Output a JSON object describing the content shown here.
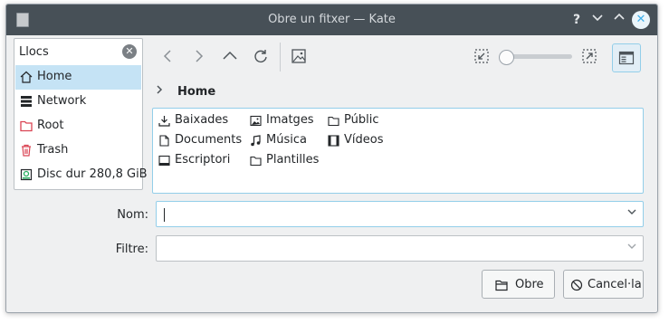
{
  "window": {
    "title": "Obre un fitxer — Kate"
  },
  "titlebar": {
    "help": "?",
    "close": "✕"
  },
  "places": {
    "header": "Llocs",
    "items": [
      {
        "label": "Home",
        "icon": "home-icon",
        "selected": true
      },
      {
        "label": "Network",
        "icon": "network-icon"
      },
      {
        "label": "Root",
        "icon": "folder-red-icon",
        "color": "#da4453"
      },
      {
        "label": "Trash",
        "icon": "trash-icon",
        "color": "#da4453"
      },
      {
        "label": "Disc dur 280,8 GiB",
        "icon": "drive-icon",
        "color": "#27ae60"
      }
    ]
  },
  "toolbar": {
    "back": "back-icon",
    "forward": "forward-icon",
    "up": "up-icon",
    "reload": "reload-icon",
    "preview": "image-preview-icon",
    "zoom_out": "zoom-out-icon",
    "zoom_in": "zoom-in-icon",
    "zoom_level": 0,
    "panel": "show-panel-icon"
  },
  "breadcrumb": {
    "path": "Home"
  },
  "files": [
    {
      "label": "Baixades",
      "icon": "download-folder-icon"
    },
    {
      "label": "Documents",
      "icon": "document-folder-icon"
    },
    {
      "label": "Escriptori",
      "icon": "desktop-folder-icon"
    },
    {
      "label": "Imatges",
      "icon": "pictures-folder-icon"
    },
    {
      "label": "Música",
      "icon": "music-folder-icon"
    },
    {
      "label": "Plantilles",
      "icon": "folder-icon"
    },
    {
      "label": "Públic",
      "icon": "folder-icon"
    },
    {
      "label": "Vídeos",
      "icon": "video-folder-icon"
    }
  ],
  "form": {
    "name_label": "Nom:",
    "name_value": "",
    "filter_label": "Filtre:",
    "filter_value": ""
  },
  "buttons": {
    "open": "Obre",
    "cancel": "Cancel·la"
  },
  "colors": {
    "titlebar": "#475057",
    "accent": "#3daee9",
    "selection": "#c5e3f5"
  }
}
